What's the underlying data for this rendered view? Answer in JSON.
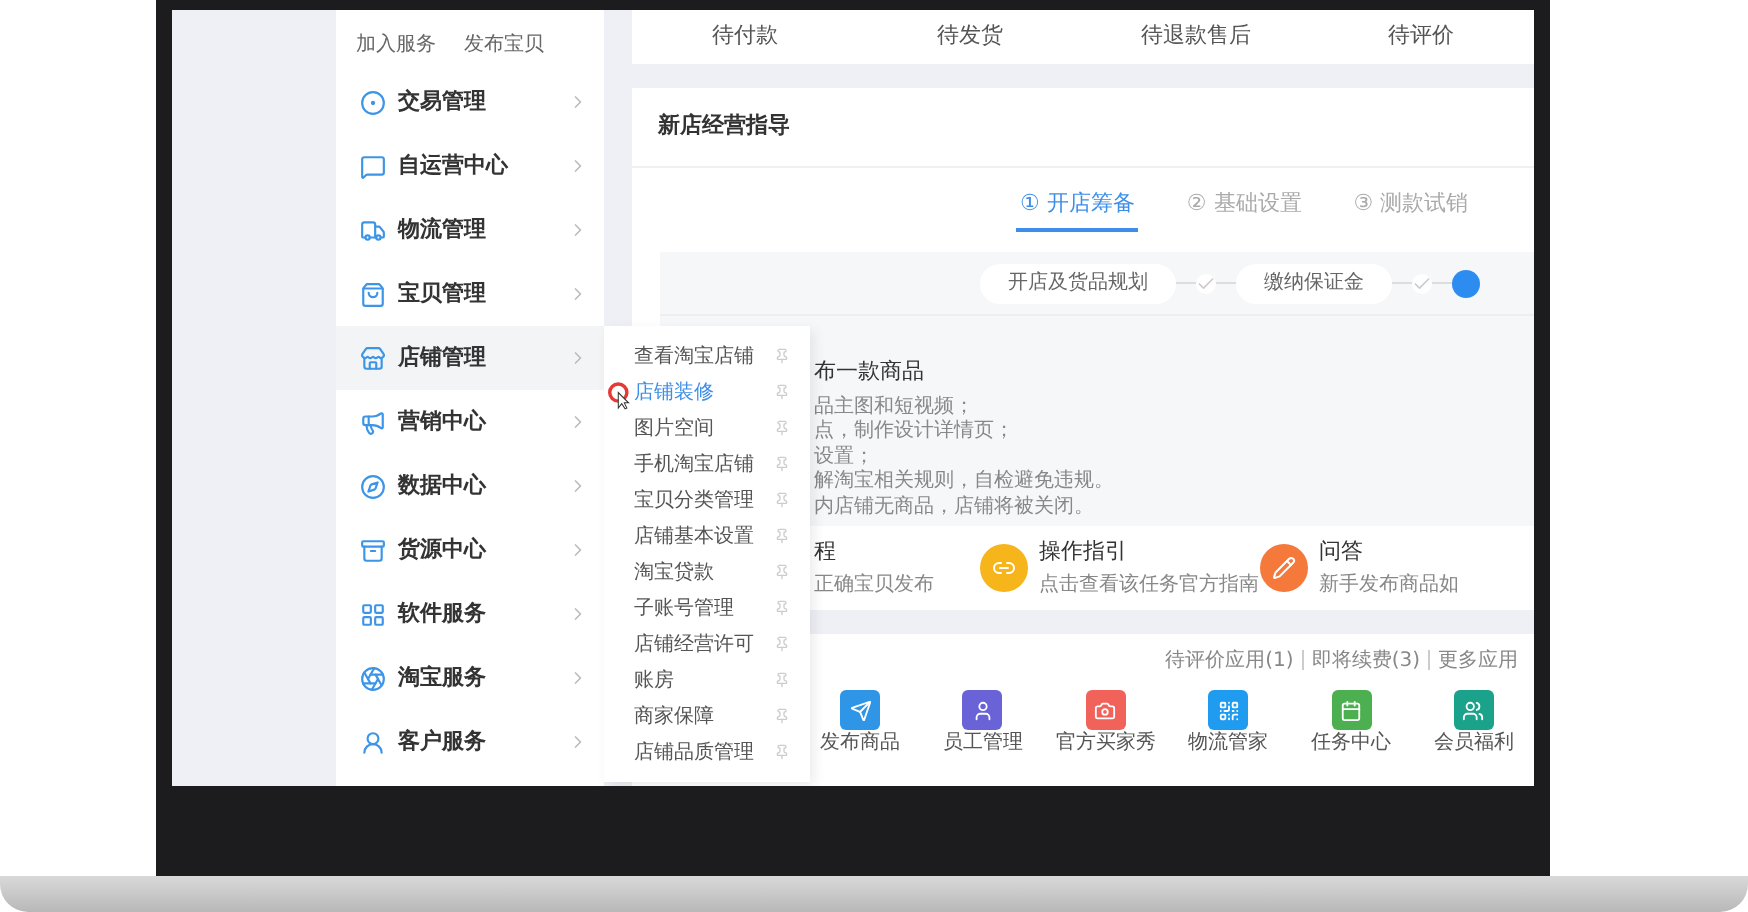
{
  "sidebar": {
    "links": [
      "加入服务",
      "发布宝贝"
    ],
    "items": [
      {
        "label": "交易管理",
        "selected": false
      },
      {
        "label": "自运营中心",
        "selected": false
      },
      {
        "label": "物流管理",
        "selected": false
      },
      {
        "label": "宝贝管理",
        "selected": false
      },
      {
        "label": "店铺管理",
        "selected": true
      },
      {
        "label": "营销中心",
        "selected": false
      },
      {
        "label": "数据中心",
        "selected": false
      },
      {
        "label": "货源中心",
        "selected": false
      },
      {
        "label": "软件服务",
        "selected": false
      },
      {
        "label": "淘宝服务",
        "selected": false
      },
      {
        "label": "客户服务",
        "selected": false
      }
    ]
  },
  "flyout": {
    "items": [
      {
        "label": "查看淘宝店铺",
        "selected": false
      },
      {
        "label": "店铺装修",
        "selected": true
      },
      {
        "label": "图片空间",
        "selected": false
      },
      {
        "label": "手机淘宝店铺",
        "selected": false
      },
      {
        "label": "宝贝分类管理",
        "selected": false
      },
      {
        "label": "店铺基本设置",
        "selected": false
      },
      {
        "label": "淘宝贷款",
        "selected": false
      },
      {
        "label": "子账号管理",
        "selected": false
      },
      {
        "label": "店铺经营许可",
        "selected": false
      },
      {
        "label": "账房",
        "selected": false
      },
      {
        "label": "商家保障",
        "selected": false
      },
      {
        "label": "店铺品质管理",
        "selected": false
      }
    ]
  },
  "order_stats": [
    "待付款",
    "待发货",
    "待退款售后",
    "待评价"
  ],
  "guide": {
    "title": "新店经营指导",
    "steps": [
      {
        "number": "①",
        "label": "开店筹备",
        "selected": true
      },
      {
        "number": "②",
        "label": "基础设置",
        "selected": false
      },
      {
        "number": "③",
        "label": "测款试销",
        "selected": false
      }
    ],
    "milestones": [
      "开店及货品规划",
      "缴纳保证金"
    ],
    "task_title": "布一款商品",
    "task_lines": [
      "品主图和短视频；",
      "点，制作设计详情页；",
      "设置；",
      "解淘宝相关规则，自检避免违规。",
      "内店铺无商品，店铺将被关闭。"
    ],
    "help": [
      {
        "title": "程",
        "subtitle": "正确宝贝发布"
      },
      {
        "title": "操作指引",
        "subtitle": "点击查看该任务官方指南",
        "color": "#f5b51b"
      },
      {
        "title": "问答",
        "subtitle": "新手发布商品如",
        "color": "#f5793b"
      }
    ]
  },
  "apps": {
    "links": [
      "待评价应用(1)",
      "即将续费(3)",
      "更多应用"
    ],
    "items": [
      {
        "label": "发布商品",
        "color": "#2f95e6"
      },
      {
        "label": "员工管理",
        "color": "#6a63d8"
      },
      {
        "label": "官方买家秀",
        "color": "#f0625a"
      },
      {
        "label": "物流管家",
        "color": "#1f9bf0"
      },
      {
        "label": "任务中心",
        "color": "#4caf50"
      },
      {
        "label": "会员福利",
        "color": "#1aa38a"
      }
    ]
  }
}
